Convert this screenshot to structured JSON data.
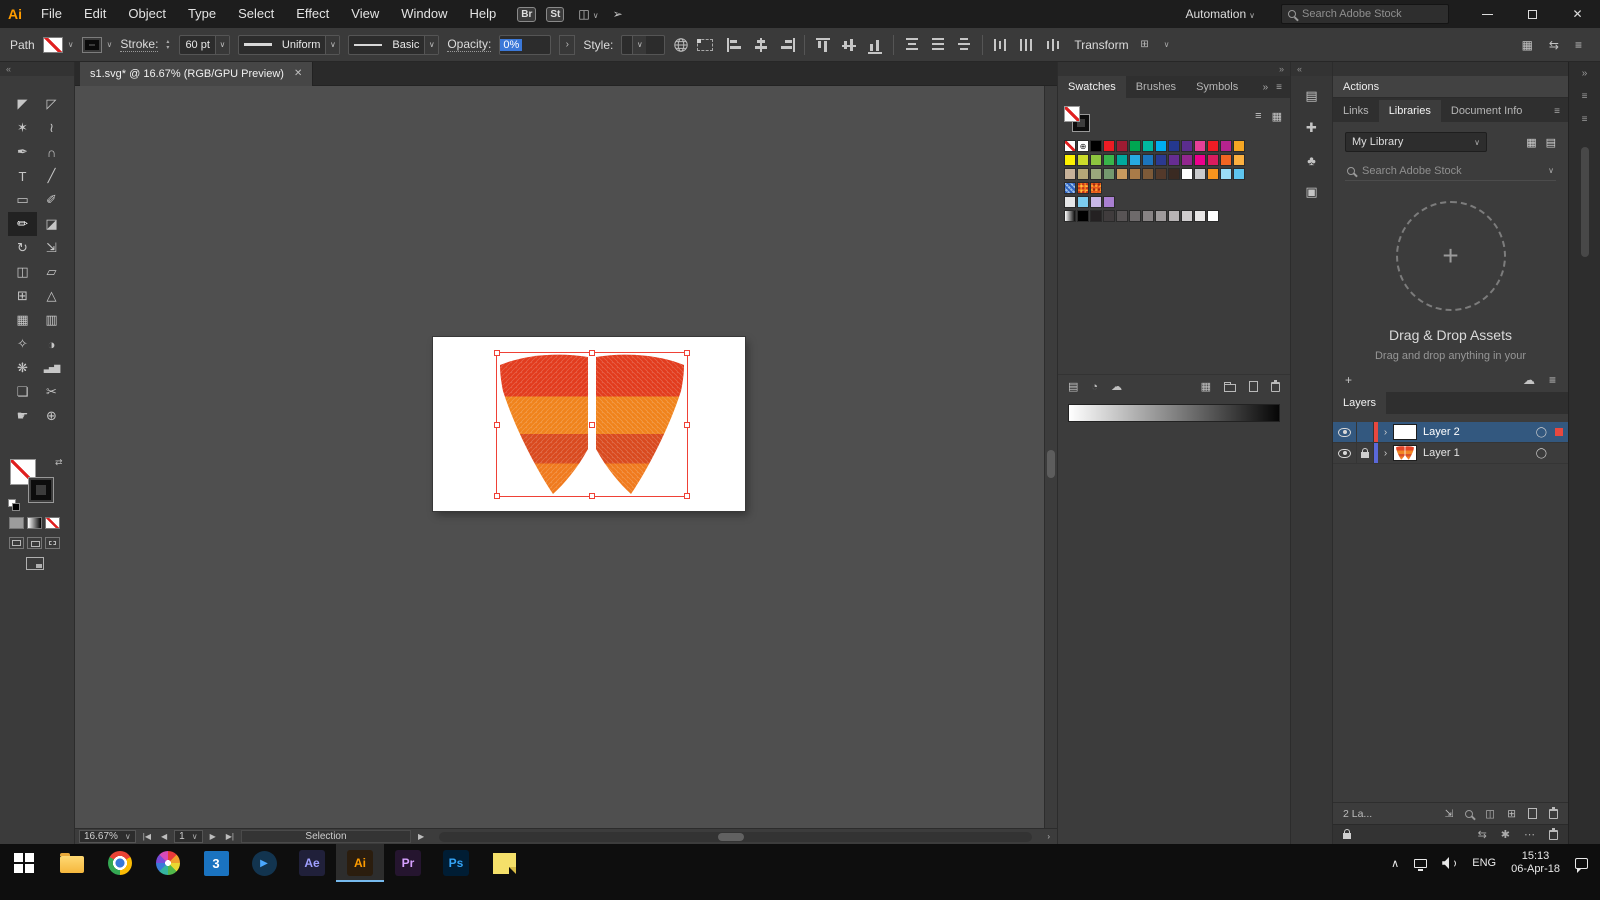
{
  "app": {
    "logo": "Ai"
  },
  "menu_bar": {
    "items": [
      "File",
      "Edit",
      "Object",
      "Type",
      "Select",
      "Effect",
      "View",
      "Window",
      "Help"
    ],
    "bridge": "Br",
    "stock": "St",
    "workspace": "Automation",
    "search_placeholder": "Search Adobe Stock"
  },
  "control_bar": {
    "context": "Path",
    "stroke_label": "Stroke:",
    "stroke_value": "60 pt",
    "profile": "Uniform",
    "brush": "Basic",
    "opacity_label": "Opacity:",
    "opacity_value": "0%",
    "style_label": "Style:",
    "transform_label": "Transform",
    "align_icons": [
      "align-left",
      "align-center",
      "align-right",
      "valign-top",
      "valign-middle",
      "valign-bottom",
      "dist-top",
      "dist-middle",
      "dist-bottom",
      "dist-left",
      "dist-center",
      "dist-right"
    ]
  },
  "document": {
    "tab": "s1.svg* @ 16.67% (RGB/GPU Preview)"
  },
  "tools": {
    "active_index": 10,
    "list": [
      {
        "name": "selection-tool",
        "glyph": "◤"
      },
      {
        "name": "direct-selection-tool",
        "glyph": "◸"
      },
      {
        "name": "magic-wand-tool",
        "glyph": "✶"
      },
      {
        "name": "lasso-tool",
        "glyph": "≀"
      },
      {
        "name": "pen-tool",
        "glyph": "✒"
      },
      {
        "name": "curvature-tool",
        "glyph": "∩"
      },
      {
        "name": "type-tool",
        "glyph": "T"
      },
      {
        "name": "line-segment-tool",
        "glyph": "╱"
      },
      {
        "name": "rectangle-tool",
        "glyph": "▭"
      },
      {
        "name": "paintbrush-tool",
        "glyph": "✐"
      },
      {
        "name": "pencil-tool",
        "glyph": "✏"
      },
      {
        "name": "eraser-tool",
        "glyph": "◪"
      },
      {
        "name": "rotate-tool",
        "glyph": "↻"
      },
      {
        "name": "scale-tool",
        "glyph": "⇲"
      },
      {
        "name": "width-tool",
        "glyph": "◫"
      },
      {
        "name": "free-transform-tool",
        "glyph": "▱"
      },
      {
        "name": "shape-builder-tool",
        "glyph": "⊞"
      },
      {
        "name": "perspective-grid-tool",
        "glyph": "△"
      },
      {
        "name": "mesh-tool",
        "glyph": "▦"
      },
      {
        "name": "gradient-tool",
        "glyph": "▥"
      },
      {
        "name": "eyedropper-tool",
        "glyph": "✧"
      },
      {
        "name": "blend-tool",
        "glyph": "◑"
      },
      {
        "name": "symbol-sprayer-tool",
        "glyph": "❋"
      },
      {
        "name": "column-graph-tool",
        "glyph": "▃▅▇"
      },
      {
        "name": "artboard-tool",
        "glyph": "❏"
      },
      {
        "name": "slice-tool",
        "glyph": "✂"
      },
      {
        "name": "hand-tool",
        "gly_alt": "hand",
        "glyph": "☛"
      },
      {
        "name": "zoom-tool",
        "glyph": "⊕"
      }
    ]
  },
  "swatches": {
    "tabs": [
      "Swatches",
      "Brushes",
      "Symbols"
    ],
    "rows": [
      [
        "none",
        "reg",
        "#000000",
        "#ec1c24",
        "#9e1b32",
        "#00a651",
        "#00b7a0",
        "#00aeef",
        "#24388f",
        "#5b2d8e",
        "#e54098",
        "#ee1c25",
        "#b5238f",
        "#f5a623"
      ],
      [
        "#fff200",
        "#cbdb2a",
        "#8dc63f",
        "#39b54a",
        "#00a99d",
        "#27aae1",
        "#1c75bc",
        "#2b3990",
        "#662d91",
        "#92278f",
        "#ec008c",
        "#db1c5e",
        "#f26522",
        "#fbb040"
      ],
      [
        "#c7b299",
        "#b5a878",
        "#9aa87c",
        "#74996e",
        "#c89a5e",
        "#a97b48",
        "#7d5a38",
        "#53392a",
        "#3a2a22",
        "#ffffff",
        "#c9cacc",
        "#f7941d",
        "#9adcf5",
        "#5ec5ee"
      ],
      [
        "pat-blue",
        "pat-orange",
        "pat-orange2"
      ],
      [
        "#e6e7e8",
        "#7ccdf0",
        "#c9b8e8",
        "#a97fd1"
      ],
      [
        "grad",
        "#000000",
        "#242122",
        "#403c3d",
        "#585455",
        "#6e6a6b",
        "#878384",
        "#9e9a9b",
        "#b7b3b4",
        "#cfcccd",
        "#e8e6e6",
        "#ffffff"
      ]
    ]
  },
  "libraries": {
    "actions": "Actions",
    "tabs": [
      "Links",
      "Libraries",
      "Document Info"
    ],
    "library": "My Library",
    "search_placeholder": "Search Adobe Stock",
    "drop_title": "Drag & Drop Assets",
    "drop_sub": "Drag and drop anything in your"
  },
  "layers": {
    "title": "Layers",
    "count": "2 La...",
    "rows": [
      {
        "name": "Layer 2",
        "color": "#e8483f",
        "selected": true,
        "locked": false,
        "thumb": "blank"
      },
      {
        "name": "Layer 1",
        "color": "#5a68d8",
        "selected": false,
        "locked": true,
        "thumb": "butterfly"
      }
    ]
  },
  "status": {
    "zoom": "16.67%",
    "page": "1",
    "mode": "Selection"
  },
  "artwork": {
    "wing_colors": [
      "#e23c1e",
      "#f0831c",
      "#d94a1f",
      "#f07a1e"
    ],
    "selection_color": "#ef4136"
  },
  "taskbar": {
    "lang": "ENG",
    "time": "15:13",
    "date": "06-Apr-18",
    "apps": [
      {
        "id": "start",
        "name": "start-button"
      },
      {
        "id": "explorer",
        "name": "file-explorer"
      },
      {
        "id": "chrome",
        "name": "chrome-browser"
      },
      {
        "id": "wheel",
        "name": "color-wheel-app"
      },
      {
        "id": "badge3",
        "name": "app-badge-3",
        "label": "3"
      },
      {
        "id": "media",
        "name": "media-player"
      },
      {
        "id": "ae",
        "label": "Ae",
        "name": "after-effects",
        "bg": "#20203a",
        "fg": "#9f9fff"
      },
      {
        "id": "ai",
        "label": "Ai",
        "name": "illustrator",
        "bg": "#2b1d0e",
        "fg": "#ff9c00",
        "active": true
      },
      {
        "id": "pr",
        "label": "Pr",
        "name": "premiere-pro",
        "bg": "#25152f",
        "fg": "#d6a1ff"
      },
      {
        "id": "ps",
        "label": "Ps",
        "name": "photoshop",
        "bg": "#001d34",
        "fg": "#34a3f5"
      },
      {
        "id": "note",
        "name": "sticky-notes"
      }
    ]
  }
}
